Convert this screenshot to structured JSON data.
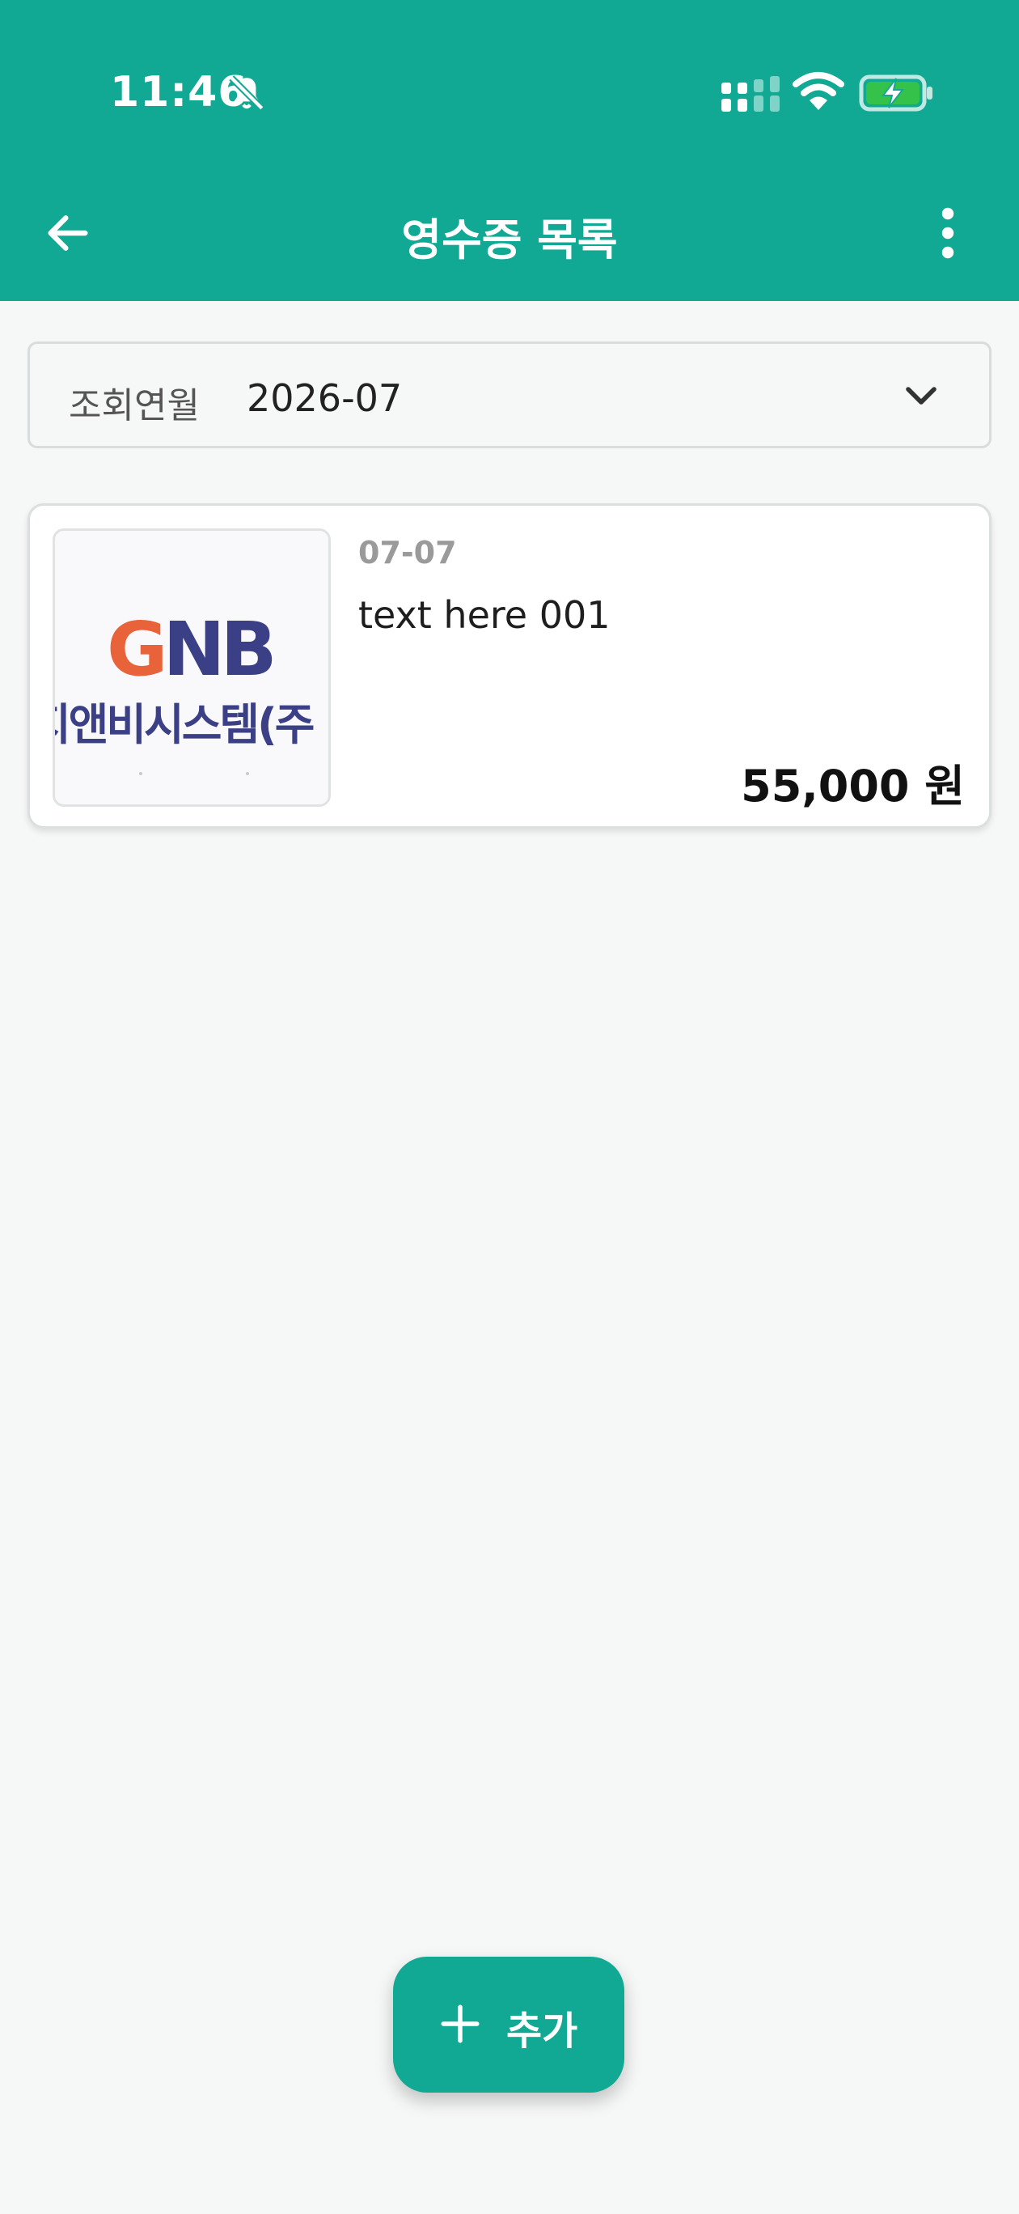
{
  "status_bar": {
    "time": "11:46",
    "icons": [
      "bell-off-icon",
      "signal-icon",
      "wifi-icon",
      "battery-charging-icon"
    ]
  },
  "app_bar": {
    "title": "영수증 목록",
    "back_icon": "arrow-left-icon",
    "menu_icon": "more-vertical-icon"
  },
  "filter": {
    "label": "조회연월",
    "value": "2026-07",
    "icon": "chevron-down-icon"
  },
  "receipts": [
    {
      "date": "07-07",
      "title": "text here 001",
      "amount": "55,000 원",
      "thumbnail": {
        "logo_text": "GNB",
        "caption_text": "지앤비시스템(주"
      }
    }
  ],
  "fab": {
    "label": "추가",
    "icon": "plus-icon"
  },
  "colors": {
    "primary": "#12a994",
    "background": "#f6f7f7",
    "logo_orange": "#e8623a",
    "logo_navy": "#3b3f86"
  }
}
